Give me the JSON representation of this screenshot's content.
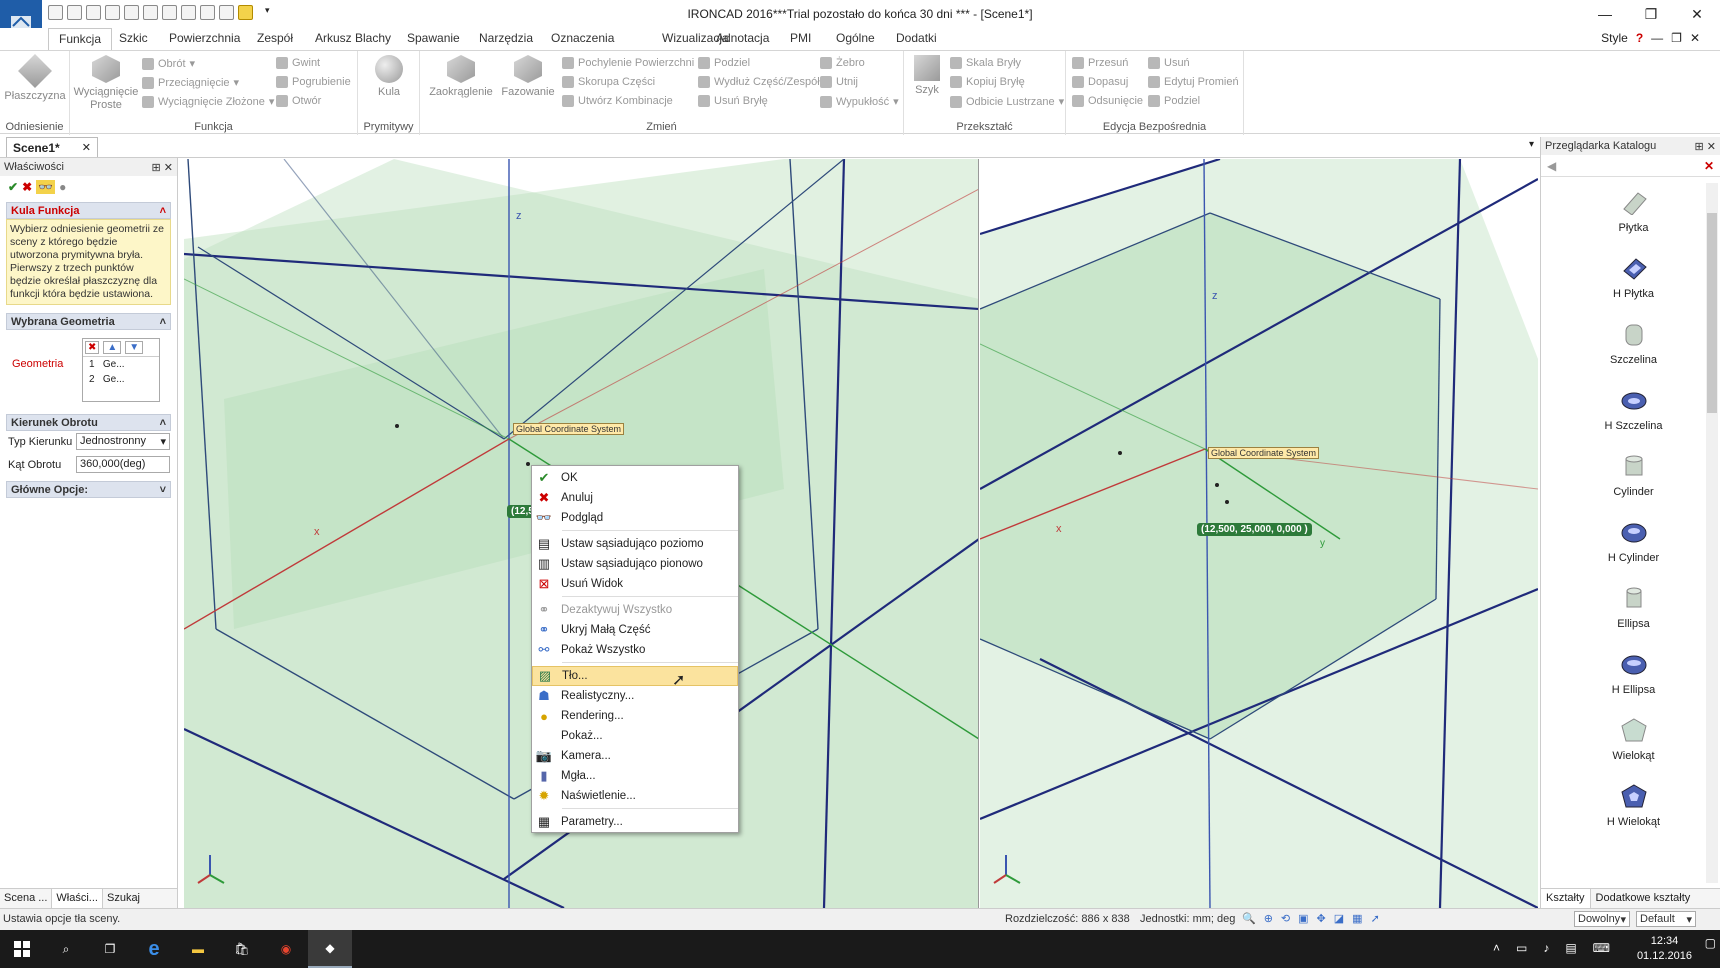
{
  "window": {
    "title": "IRONCAD 2016***Trial pozostało do końca 30 dni *** - [Scene1*]"
  },
  "ribbon_tabs": [
    "Funkcja",
    "Szkic",
    "Powierzchnia",
    "Zespół",
    "Arkusz Blachy",
    "Spawanie",
    "Narzędzia",
    "Oznaczenia",
    "Wizualizacja",
    "Adnotacja",
    "PMI",
    "Ogólne",
    "Dodatki"
  ],
  "style_label": "Style",
  "ribbon": {
    "groups": {
      "odniesienie": "Odniesienie",
      "funkcja": "Funkcja",
      "prymitywy": "Prymitywy",
      "zmien": "Zmień",
      "przeksztalc": "Przekształć",
      "edycja": "Edycja Bezpośrednia"
    },
    "plaszczyzna": "Płaszczyzna",
    "wyciagniecie_proste": "Wyciągnięcie Proste",
    "obrot": "Obrót",
    "przeciagniecie": "Przeciągnięcie",
    "wyciagniecie_zlozone": "Wyciągnięcie Złożone",
    "gwint": "Gwint",
    "pogrubienie": "Pogrubienie",
    "otwor": "Otwór",
    "kula": "Kula",
    "zaokraglenie": "Zaokrąglenie",
    "fazowanie": "Fazowanie",
    "pochylenie": "Pochylenie Powierzchni",
    "skorupa": "Skorupa Części",
    "utworz_kombinacje": "Utwórz Kombinacje",
    "podziel": "Podziel",
    "wydluz": "Wydłuż Część/Zespół",
    "usun_bryle": "Usuń Bryłę",
    "zebro": "Żebro",
    "utnij": "Utnij",
    "wypuklosc": "Wypukłość",
    "szyk": "Szyk",
    "skala_bryly": "Skala Bryły",
    "kopiuj_bryle": "Kopiuj Bryłę",
    "odbicie": "Odbicie Lustrzane",
    "przesun": "Przesuń",
    "dopasuj": "Dopasuj",
    "odsuniecie": "Odsunięcie",
    "usun": "Usuń",
    "edytuj_promien": "Edytuj Promień",
    "podziel2": "Podziel"
  },
  "doc_tab": "Scene1*",
  "left_panel": {
    "title": "Właściwości",
    "section_feature": "Kula Funkcja",
    "description": "Wybierz odniesienie geometrii ze sceny z którego będzie utworzona prymitywna bryła.\nPierwszy z trzech punktów będzie określał płaszczyznę dla funkcji która będzie ustawiona.",
    "section_geometry": "Wybrana Geometria",
    "geometry_label": "Geometria",
    "geometry_items": [
      {
        "n": "1",
        "v": "Ge..."
      },
      {
        "n": "2",
        "v": "Ge..."
      }
    ],
    "section_rotation": "Kierunek Obrotu",
    "typ_kierunku_label": "Typ Kierunku",
    "typ_kierunku_value": "Jednostronny",
    "kat_obrotu_label": "Kąt Obrotu",
    "kat_obrotu_value": "360,000(deg)",
    "section_options": "Główne Opcje:",
    "bottom_tabs": [
      "Scena ...",
      "Właści...",
      "Szukaj"
    ]
  },
  "viewport": {
    "gcs_label": "Global Coordinate System",
    "coord_left": "(12,5",
    "coord_right": "(12,500, 25,000, 0,000 )",
    "axis_x": "x",
    "axis_y": "y",
    "axis_z": "z"
  },
  "context_menu": {
    "items": [
      {
        "label": "OK",
        "icon": "check-icon",
        "disabled": false
      },
      {
        "label": "Anuluj",
        "icon": "cancel-icon",
        "disabled": false
      },
      {
        "label": "Podgląd",
        "icon": "preview-icon",
        "disabled": false
      },
      {
        "label": "Ustaw sąsiadująco poziomo",
        "icon": "tile-horizontal-icon",
        "disabled": false
      },
      {
        "label": "Ustaw sąsiadująco pionowo",
        "icon": "tile-vertical-icon",
        "disabled": false
      },
      {
        "label": "Usuń Widok",
        "icon": "delete-view-icon",
        "disabled": false
      },
      {
        "label": "Dezaktywuj Wszystko",
        "icon": "deactivate-icon",
        "disabled": true
      },
      {
        "label": "Ukryj Małą Część",
        "icon": "hide-small-icon",
        "disabled": false
      },
      {
        "label": "Pokaż Wszystko",
        "icon": "show-all-icon",
        "disabled": false
      },
      {
        "label": "Tło...",
        "icon": "background-icon",
        "disabled": false
      },
      {
        "label": "Realistyczny...",
        "icon": "realistic-icon",
        "disabled": false
      },
      {
        "label": "Rendering...",
        "icon": "rendering-icon",
        "disabled": false
      },
      {
        "label": "Pokaż...",
        "icon": "show-icon",
        "disabled": false
      },
      {
        "label": "Kamera...",
        "icon": "camera-icon",
        "disabled": false
      },
      {
        "label": "Mgła...",
        "icon": "fog-icon",
        "disabled": false
      },
      {
        "label": "Naświetlenie...",
        "icon": "lighting-icon",
        "disabled": false
      },
      {
        "label": "Parametry...",
        "icon": "parameters-icon",
        "disabled": false
      }
    ]
  },
  "catalog": {
    "title": "Przeglądarka Katalogu",
    "items": [
      "Płytka",
      "H Płytka",
      "Szczelina",
      "H Szczelina",
      "Cylinder",
      "H Cylinder",
      "Ellipsa",
      "H Ellipsa",
      "Wielokąt",
      "H Wielokąt"
    ],
    "tabs": [
      "Kształty",
      "Dodatkowe kształty"
    ]
  },
  "status": {
    "message": "Ustawia opcje tła sceny.",
    "resolution": "Rozdzielczość: 886 x 838",
    "units": "Jednostki: mm; deg",
    "mode": "Dowolny",
    "profile": "Default"
  },
  "taskbar": {
    "time": "12:34",
    "date": "01.12.2016"
  },
  "colors": {
    "accent": "#1f5da8",
    "plane": "#c8e6c9",
    "highlight": "#fbe39e"
  }
}
